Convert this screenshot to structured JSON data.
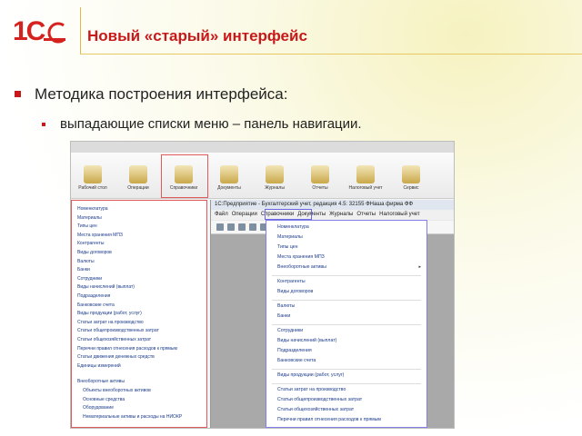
{
  "slide": {
    "title": "Новый «старый» интерфейс",
    "bullet1": "Методика построения интерфейса:",
    "bullet2": "выпадающие списки меню – панель навигации."
  },
  "logo": {
    "text": "1С"
  },
  "screenshot": {
    "toolbar_items": [
      "Рабочий стол",
      "Операции",
      "Справочники",
      "Документы",
      "Журналы",
      "Отчеты",
      "Налоговый учет",
      "Сервис"
    ],
    "left_menu": [
      "Номенклатура",
      "Материалы",
      "Типы цен",
      "Места хранения МПЗ",
      "Контрагенты",
      "Виды договоров",
      "Валюты",
      "Банки",
      "Сотрудники",
      "Виды начислений (выплат)",
      "Подразделения",
      "Банковские счета",
      "Виды продукции (работ, услуг)",
      "Статьи затрат на производство",
      "Статьи общепроизводственных затрат",
      "Статьи общехозяйственных затрат",
      "Перечни правил отнесения расходов к прямым",
      "Статьи движения денежных средств",
      "Единицы измерений",
      "Внеоборотные активы",
      "Объекты внеоборотных активов",
      "Основные средства",
      "Оборудование",
      "Нематериальные активы и расходы на НИОКР"
    ],
    "window2_title": "1С:Предприятие - Бухгалтерский учет, редакция 4.5: 32155 ФНаша фирма ФФ",
    "window2_menu": [
      "Файл",
      "Операции",
      "Справочники",
      "Документы",
      "Журналы",
      "Отчеты",
      "Налоговый учет"
    ],
    "dropdown": [
      "Номенклатура",
      "Материалы",
      "Типы цен",
      "Места хранения МПЗ",
      "Внеоборотные активы",
      "Контрагенты",
      "Виды договоров",
      "Валюты",
      "Банки",
      "Сотрудники",
      "Виды начислений (выплат)",
      "Подразделения",
      "Банковские счета",
      "Виды продукции (работ, услуг)",
      "Статьи затрат на производство",
      "Статьи общепроизводственных затрат",
      "Статьи общехозяйственных затрат",
      "Перечни правил отнесения расходов к прямым"
    ]
  }
}
